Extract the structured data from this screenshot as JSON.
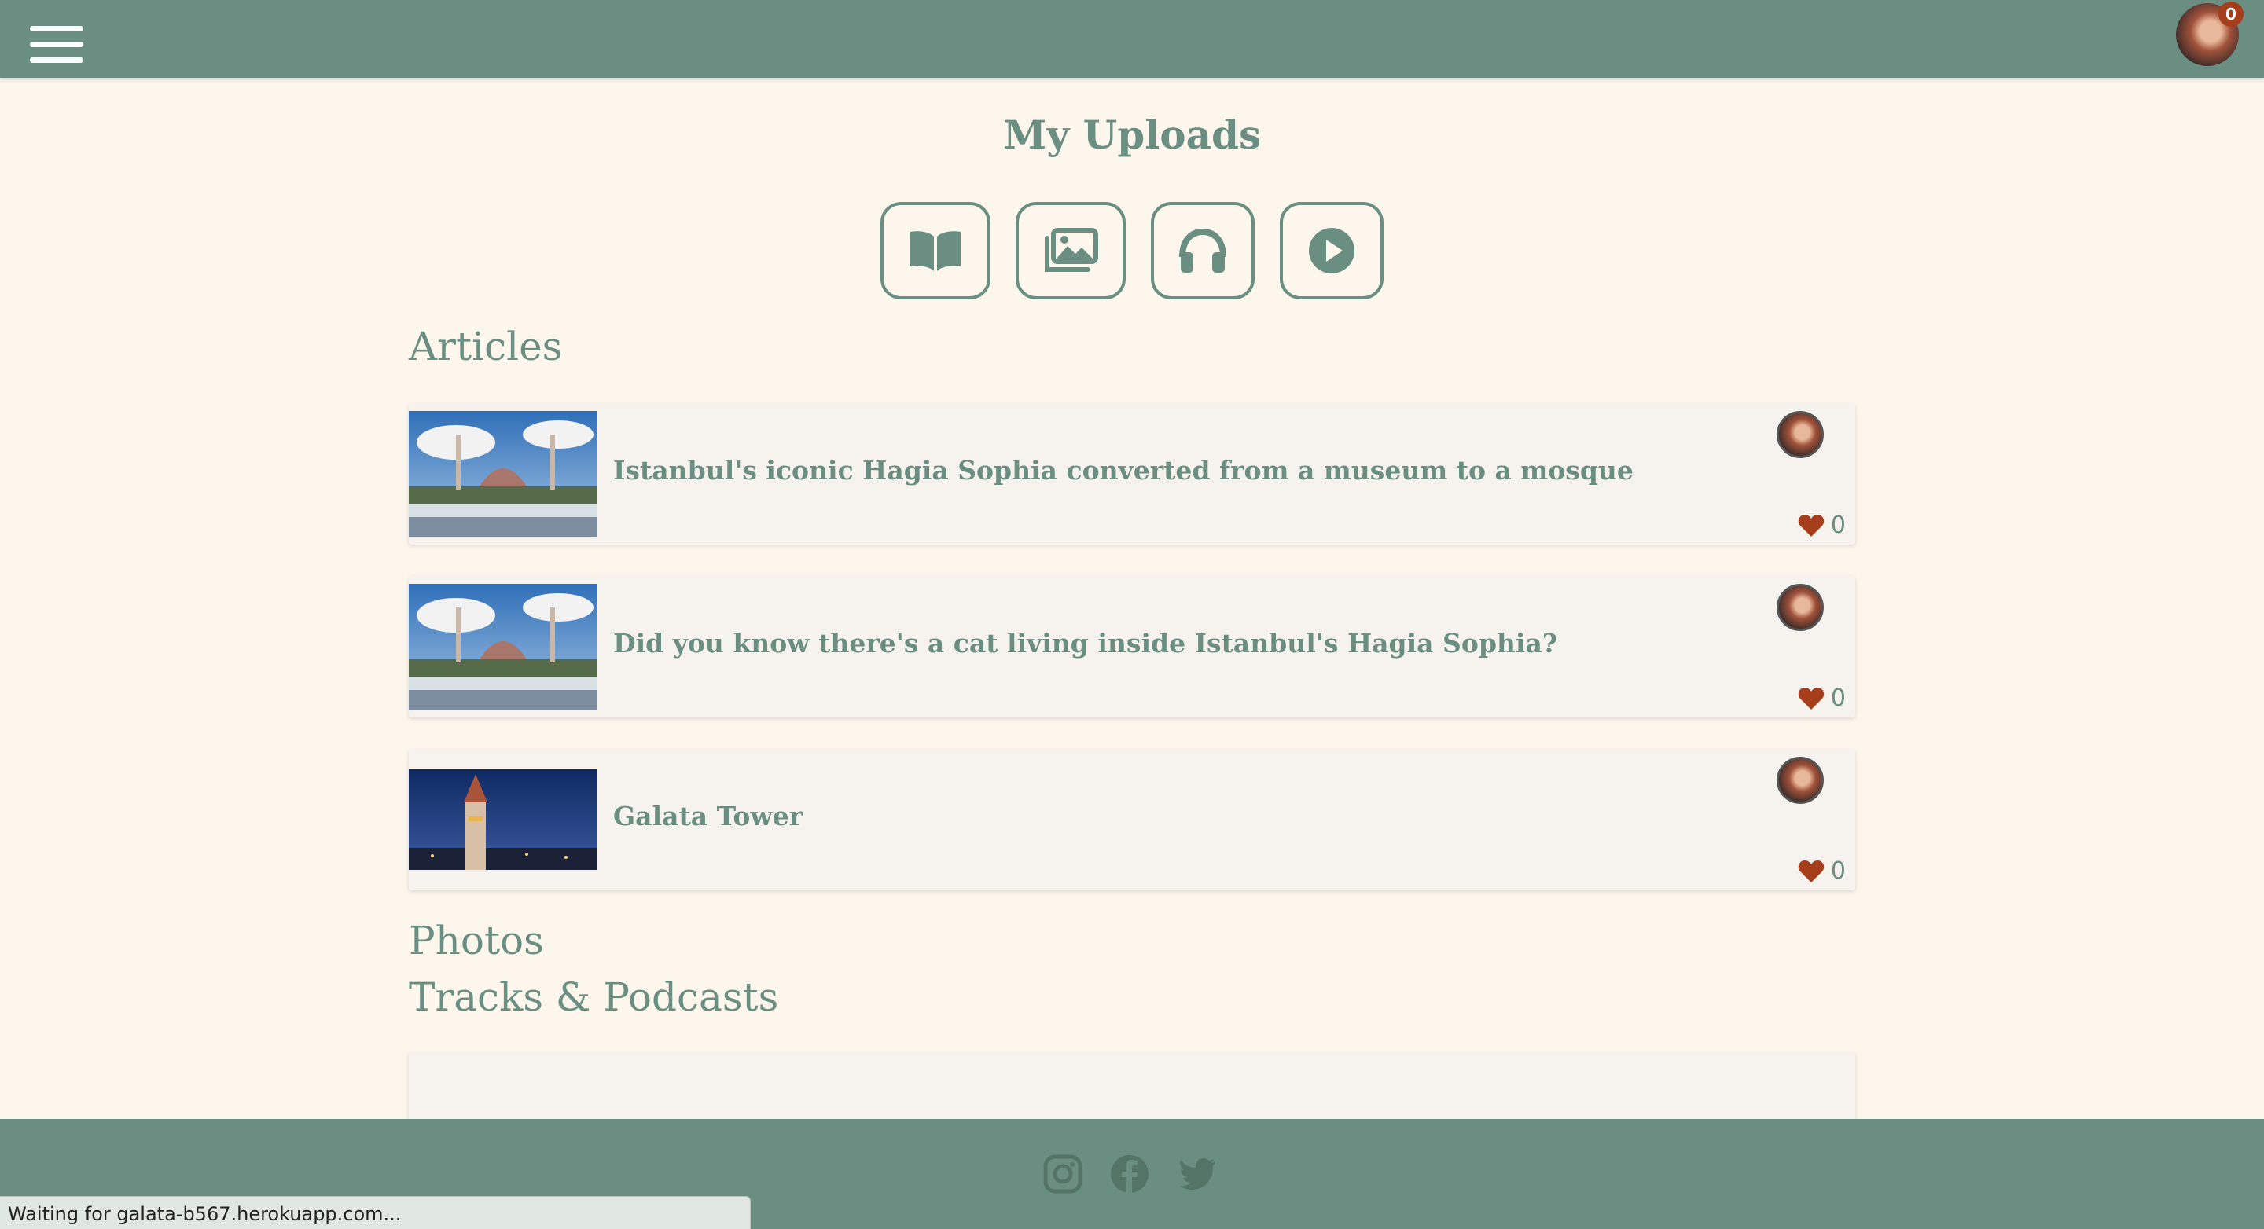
{
  "header": {
    "menu_icon": "hamburger-menu-icon",
    "notification_count": "0"
  },
  "page": {
    "title": "My Uploads"
  },
  "filters": [
    {
      "icon": "book-icon",
      "label": "Articles"
    },
    {
      "icon": "images-icon",
      "label": "Photos"
    },
    {
      "icon": "headphones-icon",
      "label": "Tracks & Podcasts"
    },
    {
      "icon": "play-circle-icon",
      "label": "Videos"
    }
  ],
  "sections": {
    "articles": "Articles",
    "photos": "Photos",
    "tracks": "Tracks & Podcasts"
  },
  "articles": [
    {
      "title": "Istanbul's iconic Hagia Sophia converted from a museum to a mosque",
      "likes": "0",
      "thumbnail": "hagia-sophia"
    },
    {
      "title": "Did you know there's a cat living inside Istanbul's Hagia Sophia?",
      "likes": "0",
      "thumbnail": "hagia-sophia"
    },
    {
      "title": "Galata Tower",
      "likes": "0",
      "thumbnail": "galata-tower-night"
    }
  ],
  "footer": {
    "social": [
      "instagram-icon",
      "facebook-icon",
      "twitter-icon"
    ]
  },
  "colors": {
    "primary": "#6a8f82",
    "background": "#fdf6ec",
    "card": "#f6f2ed",
    "heart": "#a63d1b"
  },
  "status_bar": {
    "text": "Waiting for galata-b567.herokuapp.com..."
  }
}
